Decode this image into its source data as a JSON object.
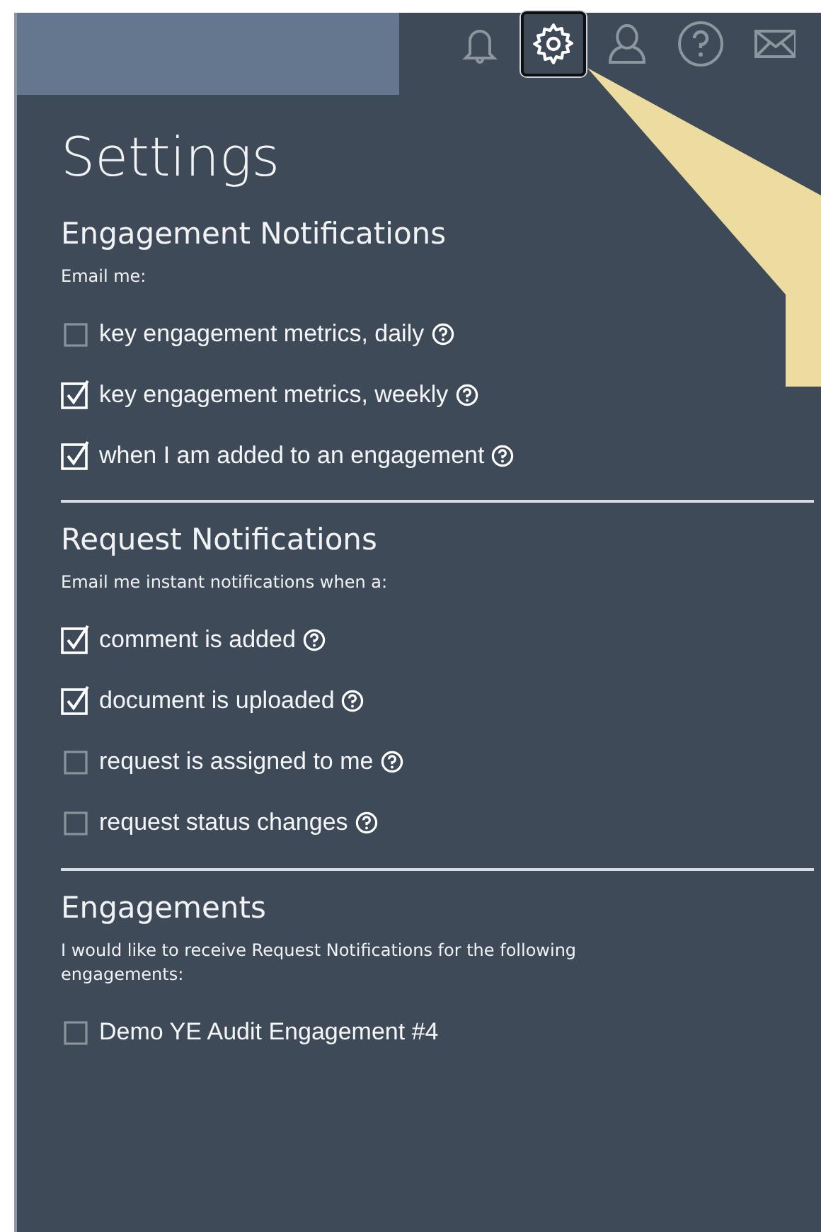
{
  "toolbar": {
    "icons": [
      {
        "kind": "bell",
        "selected": false
      },
      {
        "kind": "gear",
        "selected": true
      },
      {
        "kind": "user",
        "selected": false
      },
      {
        "kind": "help",
        "selected": false
      },
      {
        "kind": "mail",
        "selected": false
      }
    ]
  },
  "title": "Settings",
  "sections": [
    {
      "heading": "Engagement Notifications",
      "intro": "Email me:",
      "options": [
        {
          "label": "key engagement metrics, daily",
          "checked": false,
          "help": true
        },
        {
          "label": "key engagement metrics, weekly",
          "checked": true,
          "help": true
        },
        {
          "label": "when I am added to an engagement",
          "checked": true,
          "help": true
        }
      ]
    },
    {
      "heading": "Request Notifications",
      "intro": "Email me instant notifications when a:",
      "options": [
        {
          "label": "comment is added",
          "checked": true,
          "help": true
        },
        {
          "label": "document is uploaded",
          "checked": true,
          "help": true
        },
        {
          "label": "request is assigned to me",
          "checked": false,
          "help": true
        },
        {
          "label": "request status changes",
          "checked": false,
          "help": true
        }
      ]
    },
    {
      "heading": "Engagements",
      "intro": "I would like to receive Request Notifications for the following engagements:",
      "options": [
        {
          "label": "Demo YE Audit Engagement #4",
          "checked": false,
          "help": false
        }
      ]
    }
  ]
}
